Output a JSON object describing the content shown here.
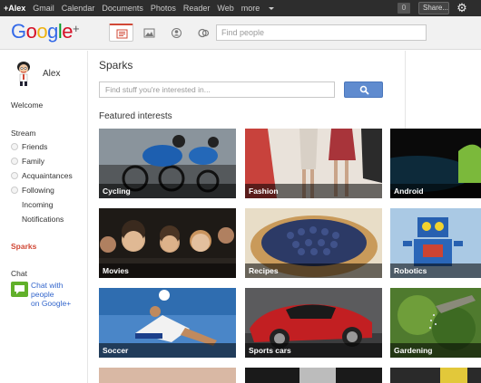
{
  "topbar": {
    "links": [
      "+Alex",
      "Gmail",
      "Calendar",
      "Documents",
      "Photos",
      "Reader",
      "Web",
      "more"
    ],
    "notification_count": "0",
    "share_label": "Share..."
  },
  "header": {
    "logo": "Google+",
    "search_placeholder": "Find people"
  },
  "sidebar": {
    "user_name": "Alex",
    "welcome": "Welcome",
    "stream": "Stream",
    "circles": [
      "Friends",
      "Family",
      "Acquaintances",
      "Following"
    ],
    "incoming": "Incoming",
    "notifications": "Notifications",
    "sparks": "Sparks",
    "chat": "Chat",
    "chat_cta_line1": "Chat with people",
    "chat_cta_line2": "on Google+"
  },
  "main": {
    "title": "Sparks",
    "search_placeholder": "Find stuff you're interested in...",
    "featured_heading": "Featured interests",
    "interests": [
      {
        "label": "Cycling"
      },
      {
        "label": "Fashion"
      },
      {
        "label": "Android"
      },
      {
        "label": "Movies"
      },
      {
        "label": "Recipes"
      },
      {
        "label": "Robotics"
      },
      {
        "label": "Soccer"
      },
      {
        "label": "Sports cars"
      },
      {
        "label": "Gardening"
      }
    ]
  },
  "colors": {
    "accent_red": "#d14836",
    "search_blue": "#5f8bcf",
    "chat_green": "#61b02a",
    "topbar": "#2d2d2d"
  }
}
